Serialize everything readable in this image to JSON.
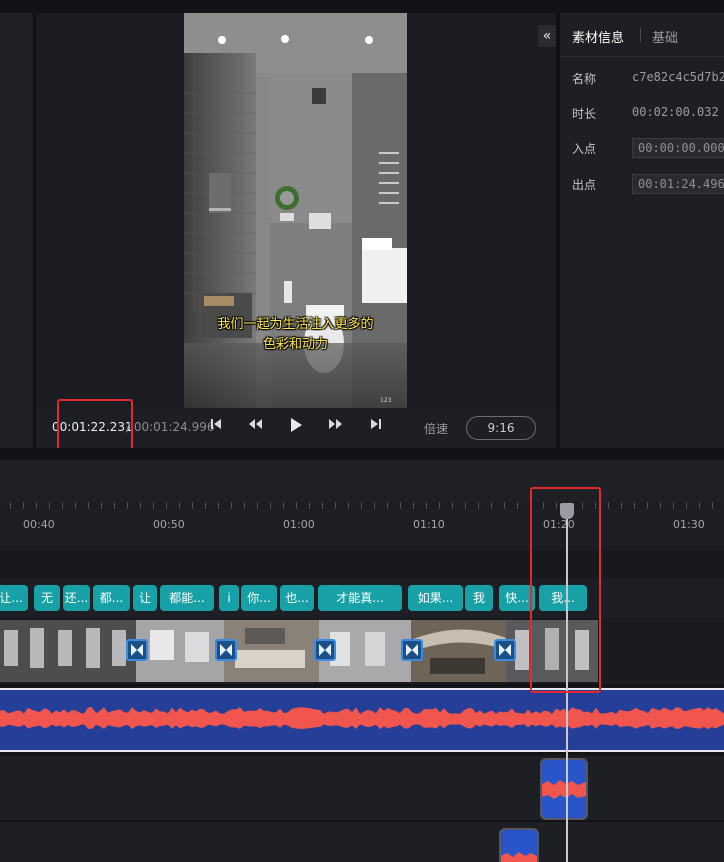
{
  "preview": {
    "subtitle_line1": "我们一起为生活注入更多的",
    "subtitle_line2": "色彩和动力",
    "collapse_glyph": "«"
  },
  "player": {
    "current_time": "00:01:22.231",
    "total_time": "/ 00:01:24.996",
    "speed_label": "倍速",
    "aspect_ratio": "9:16"
  },
  "info_panel": {
    "tabs": [
      {
        "label": "素材信息",
        "active": true
      },
      {
        "label": "基础",
        "active": false
      }
    ],
    "fields": [
      {
        "label": "名称",
        "value": "c7e82c4c5d7b2"
      },
      {
        "label": "时长",
        "value": "00:02:00.032"
      },
      {
        "label": "入点",
        "value": "00:00:00.000"
      },
      {
        "label": "出点",
        "value": "00:01:24.496"
      }
    ]
  },
  "ruler": {
    "labels": [
      "00:40",
      "00:50",
      "01:00",
      "01:10",
      "01:20",
      "01:30"
    ]
  },
  "subtitles": [
    "让...",
    "无",
    "还...",
    "都...",
    "让",
    "都能...",
    "i",
    "你...",
    "也...",
    "才能真...",
    "如果...",
    "我",
    "快...",
    "我..."
  ],
  "icons": {
    "skip_start": "skip-start-icon",
    "rewind": "rewind-icon",
    "play": "play-icon",
    "fast_forward": "fast-forward-icon",
    "skip_end": "skip-end-icon",
    "transition": "transition-icon"
  },
  "colors": {
    "subtitle_chip": "#17a1a6",
    "audio_bg": "#253f99",
    "waveform": "#f0564d",
    "highlight": "#e12b2b"
  }
}
